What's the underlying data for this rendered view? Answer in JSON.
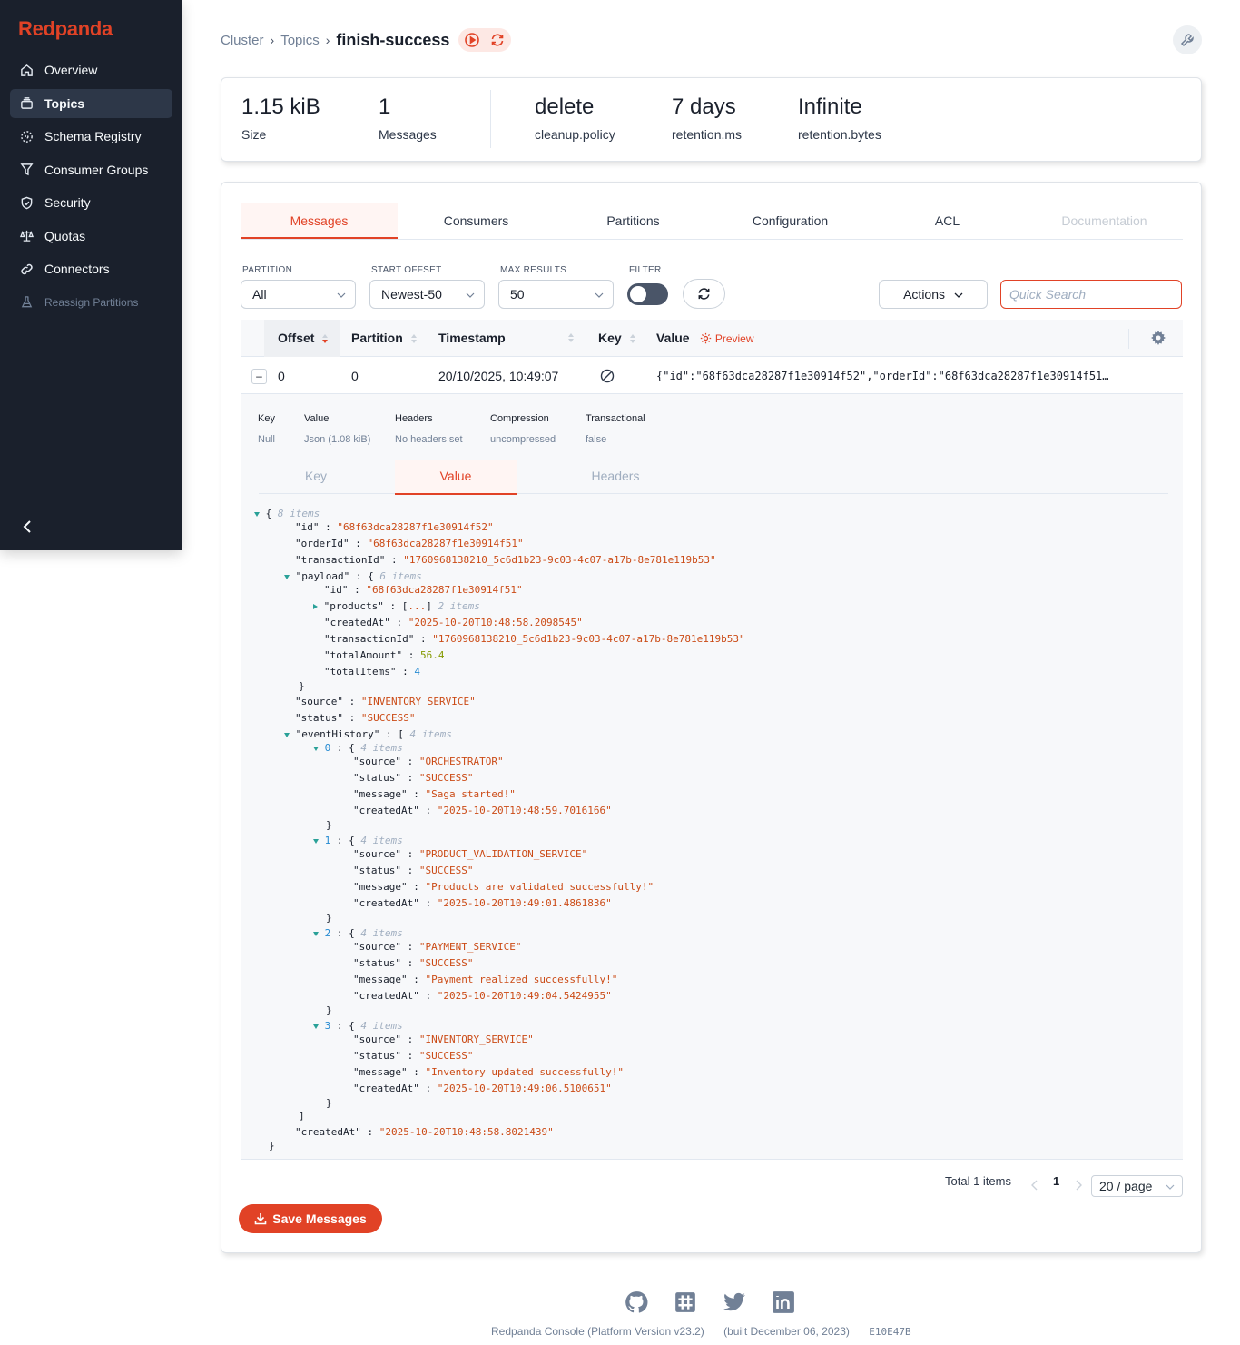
{
  "brand": {
    "name": "Redpanda",
    "accent": "#e14226"
  },
  "sidebar": {
    "items": [
      {
        "label": "Overview",
        "icon": "home-icon"
      },
      {
        "label": "Topics",
        "icon": "topics-icon",
        "active": true
      },
      {
        "label": "Schema Registry",
        "icon": "schema-icon"
      },
      {
        "label": "Consumer Groups",
        "icon": "funnel-icon"
      },
      {
        "label": "Security",
        "icon": "shield-icon"
      },
      {
        "label": "Quotas",
        "icon": "scale-icon"
      },
      {
        "label": "Connectors",
        "icon": "link-icon"
      },
      {
        "label": "Reassign Partitions",
        "icon": "flask-icon",
        "disabled": true
      }
    ],
    "collapse_icon": "chevron-left-icon"
  },
  "breadcrumb": {
    "cluster": "Cluster",
    "topics": "Topics",
    "current": "finish-success"
  },
  "stats": [
    {
      "value": "1.15 kiB",
      "label": "Size"
    },
    {
      "value": "1",
      "label": "Messages"
    },
    {
      "value": "delete",
      "label": "cleanup.policy"
    },
    {
      "value": "7 days",
      "label": "retention.ms"
    },
    {
      "value": "Infinite",
      "label": "retention.bytes"
    }
  ],
  "tabs": [
    "Messages",
    "Consumers",
    "Partitions",
    "Configuration",
    "ACL",
    "Documentation"
  ],
  "filters": {
    "partition_label": "PARTITION",
    "partition_value": "All",
    "offset_label": "START OFFSET",
    "offset_value": "Newest-50",
    "max_label": "MAX RESULTS",
    "max_value": "50",
    "filter_label": "FILTER",
    "actions_label": "Actions",
    "search_placeholder": "Quick Search"
  },
  "table": {
    "headers": {
      "offset": "Offset",
      "partition": "Partition",
      "timestamp": "Timestamp",
      "key": "Key",
      "value": "Value",
      "preview": "Preview"
    },
    "row": {
      "offset": "0",
      "partition": "0",
      "timestamp": "20/10/2025, 10:49:07",
      "value": "{\"id\":\"68f63dca28287f1e30914f52\",\"orderId\":\"68f63dca28287f1e30914f51…"
    }
  },
  "detail": {
    "meta": [
      {
        "k": "Key",
        "v": "Null"
      },
      {
        "k": "Value",
        "v": "Json (1.08 kiB)"
      },
      {
        "k": "Headers",
        "v": "No headers set"
      },
      {
        "k": "Compression",
        "v": "uncompressed"
      },
      {
        "k": "Transactional",
        "v": "false"
      }
    ],
    "subtabs": [
      "Key",
      "Value",
      "Headers"
    ],
    "json": {
      "root_count": "8 items",
      "id": "\"68f63dca28287f1e30914f52\"",
      "orderId": "\"68f63dca28287f1e30914f51\"",
      "transactionId": "\"1760968138210_5c6d1b23-9c03-4c07-a17b-8e781e119b53\"",
      "payload_count": "6 items",
      "payload_id": "\"68f63dca28287f1e30914f51\"",
      "products_count": "2 items",
      "payload_createdAt": "\"2025-10-20T10:48:58.2098545\"",
      "payload_transactionId": "\"1760968138210_5c6d1b23-9c03-4c07-a17b-8e781e119b53\"",
      "totalAmount": "56.4",
      "totalItems": "4",
      "source": "\"INVENTORY_SERVICE\"",
      "status": "\"SUCCESS\"",
      "history_count": "4 items",
      "history": [
        {
          "count": "4 items",
          "source": "\"ORCHESTRATOR\"",
          "status": "\"SUCCESS\"",
          "message": "\"Saga started!\"",
          "createdAt": "\"2025-10-20T10:48:59.7016166\""
        },
        {
          "count": "4 items",
          "source": "\"PRODUCT_VALIDATION_SERVICE\"",
          "status": "\"SUCCESS\"",
          "message": "\"Products are validated successfully!\"",
          "createdAt": "\"2025-10-20T10:49:01.4861836\""
        },
        {
          "count": "4 items",
          "source": "\"PAYMENT_SERVICE\"",
          "status": "\"SUCCESS\"",
          "message": "\"Payment realized successfully!\"",
          "createdAt": "\"2025-10-20T10:49:04.5424955\""
        },
        {
          "count": "4 items",
          "source": "\"INVENTORY_SERVICE\"",
          "status": "\"SUCCESS\"",
          "message": "\"Inventory updated successfully!\"",
          "createdAt": "\"2025-10-20T10:49:06.5100651\""
        }
      ],
      "createdAt": "\"2025-10-20T10:48:58.8021439\""
    }
  },
  "pagination": {
    "total": "Total 1 items",
    "page": "1",
    "page_size": "20 / page"
  },
  "save_label": "Save Messages",
  "footer": {
    "version": "Redpanda Console (Platform Version v23.2)",
    "built": "(built December 06, 2023)",
    "hash": "E10E47B"
  }
}
